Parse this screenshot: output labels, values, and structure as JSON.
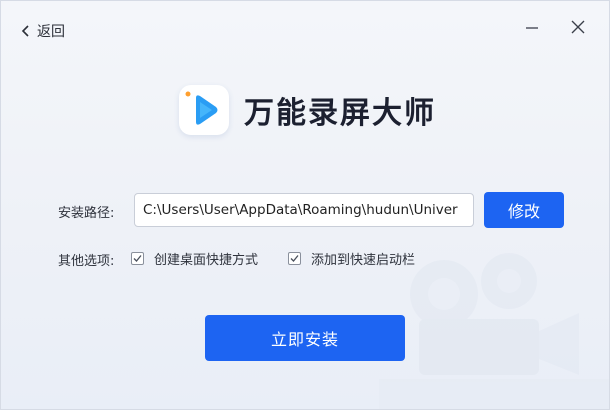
{
  "titlebar": {
    "back_label": "返回",
    "back_icon": "chevron-left-icon",
    "minimize_icon": "minimize-icon",
    "close_icon": "close-icon"
  },
  "brand": {
    "title": "万能录屏大师",
    "logo_icon": "play-logo-icon",
    "accent_color": "#1d64f2"
  },
  "install_path": {
    "label": "安装路径:",
    "value": "C:\\Users\\User\\AppData\\Roaming\\hudun\\Univer",
    "modify_label": "修改"
  },
  "options": {
    "label": "其他选项:",
    "items": [
      {
        "label": "创建桌面快捷方式",
        "checked": true
      },
      {
        "label": "添加到快速启动栏",
        "checked": true
      }
    ]
  },
  "install_button_label": "立即安装"
}
